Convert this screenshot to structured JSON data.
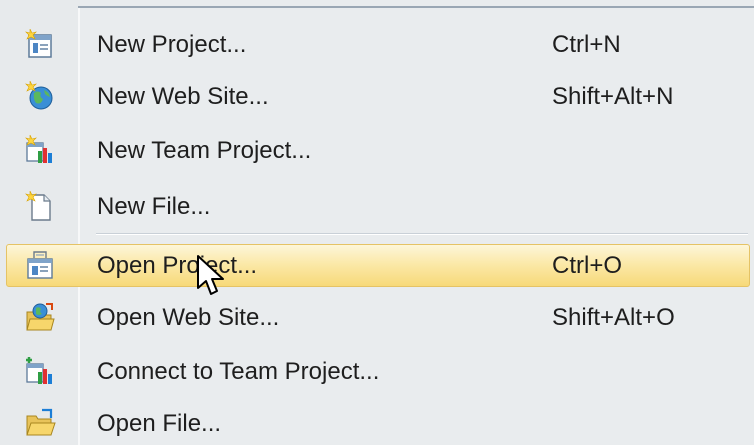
{
  "menu": {
    "items": [
      {
        "label": "New Project...",
        "shortcut": "Ctrl+N",
        "icon": "new-project-icon"
      },
      {
        "label": "New Web Site...",
        "shortcut": "Shift+Alt+N",
        "icon": "new-web-site-icon"
      },
      {
        "label": "New Team Project...",
        "shortcut": "",
        "icon": "new-team-project-icon"
      },
      {
        "label": "New File...",
        "shortcut": "",
        "icon": "new-file-icon"
      },
      {
        "label": "Open Project...",
        "shortcut": "Ctrl+O",
        "icon": "open-project-icon",
        "highlighted": true
      },
      {
        "label": "Open Web Site...",
        "shortcut": "Shift+Alt+O",
        "icon": "open-web-site-icon"
      },
      {
        "label": "Connect to Team Project...",
        "shortcut": "",
        "icon": "connect-team-project-icon"
      },
      {
        "label": "Open File...",
        "shortcut": "",
        "icon": "open-file-icon"
      }
    ]
  },
  "colors": {
    "menu_background": "#e9ecee",
    "highlight_top": "#fdf6d9",
    "highlight_bottom": "#f7d979",
    "highlight_border": "#e5c365",
    "text": "#1e1e1e"
  }
}
